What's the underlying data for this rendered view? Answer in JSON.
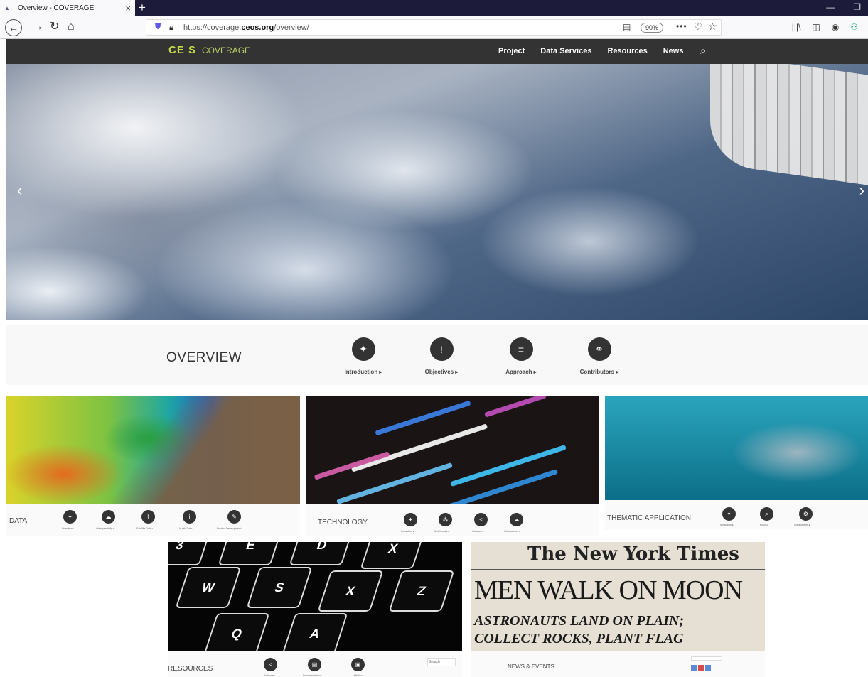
{
  "browser": {
    "tab_title": "Overview - COVERAGE",
    "url_plain": "https://coverage.",
    "url_bold": "ceos.org",
    "url_path": "/overview/",
    "zoom": "90%"
  },
  "site": {
    "logo_ceos": "CE S",
    "logo_coverage": "COVERAGE",
    "nav": [
      "Project",
      "Data Services",
      "Resources",
      "News"
    ]
  },
  "overview": {
    "title": "OVERVIEW",
    "items": [
      {
        "label": "Introduction ▸",
        "icon": "lightbulb-icon"
      },
      {
        "label": "Objectives ▸",
        "icon": "exclamation-icon"
      },
      {
        "label": "Approach ▸",
        "icon": "list-icon"
      },
      {
        "label": "Contributors ▸",
        "icon": "handshake-icon"
      }
    ]
  },
  "tiles": {
    "data": {
      "label": "DATA",
      "subs": [
        "Overview ▸",
        "Interoperability ▸",
        "Satellite Data ▸",
        "In-situ Data ▸",
        "Product Development ▸"
      ]
    },
    "technology": {
      "label": "TECHNOLOGY",
      "subs": [
        "Innovation ▸",
        "Architecture ▸",
        "Software ▸",
        "Infrastructure ▸"
      ]
    },
    "thematic": {
      "label": "THEMATIC APPLICATION",
      "subs": [
        "Motivation ▸",
        "Focus ▸",
        "Components ▸"
      ]
    },
    "resources": {
      "label": "RESOURCES",
      "subs": [
        "Software ▸",
        "Documentation ▸",
        "Media ▸"
      ],
      "search_placeholder": "Search"
    },
    "news": {
      "label": "NEWS & EVENTS",
      "masthead": "The New York Times",
      "headline1": "MEN WALK ON MOON",
      "headline2": "ASTRONAUTS LAND ON PLAIN;",
      "headline3": "COLLECT ROCKS, PLANT FLAG"
    }
  }
}
